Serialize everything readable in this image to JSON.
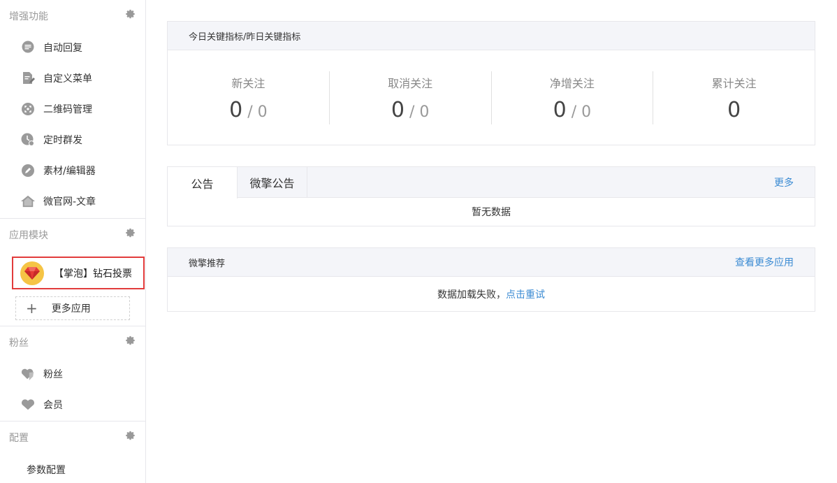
{
  "sidebar": {
    "enhanced": {
      "title": "增强功能",
      "items": [
        {
          "label": "自动回复",
          "icon": "chat-bubble-icon"
        },
        {
          "label": "自定义菜单",
          "icon": "document-edit-icon"
        },
        {
          "label": "二维码管理",
          "icon": "qrcode-scan-icon"
        },
        {
          "label": "定时群发",
          "icon": "clock-send-icon"
        },
        {
          "label": "素材/编辑器",
          "icon": "pencil-icon"
        },
        {
          "label": "微官网-文章",
          "icon": "home-icon"
        }
      ]
    },
    "apps": {
      "title": "应用模块",
      "app_item": {
        "label": "【掌泡】钻石投票",
        "icon": "diamond-icon"
      },
      "more_label": "更多应用"
    },
    "fans": {
      "title": "粉丝",
      "items": [
        {
          "label": "粉丝",
          "icon": "heart-tag-icon"
        },
        {
          "label": "会员",
          "icon": "heart-icon"
        }
      ]
    },
    "config": {
      "title": "配置",
      "item_label": "参数配置"
    }
  },
  "metrics": {
    "title": "今日关键指标/昨日关键指标",
    "items": [
      {
        "label": "新关注",
        "today": "0",
        "yesterday": "0"
      },
      {
        "label": "取消关注",
        "today": "0",
        "yesterday": "0"
      },
      {
        "label": "净增关注",
        "today": "0",
        "yesterday": "0"
      },
      {
        "label": "累计关注",
        "today": "0"
      }
    ],
    "separator": "/"
  },
  "notice": {
    "tabs": [
      "公告",
      "微擎公告"
    ],
    "more": "更多",
    "empty": "暂无数据"
  },
  "recommend": {
    "title": "微擎推荐",
    "more": "查看更多应用",
    "fail_text": "数据加载失败，",
    "retry": "点击重试"
  },
  "colors": {
    "accent_link": "#3b8bd3",
    "highlight_border": "#e23b3b",
    "icon_gray": "#999999"
  }
}
